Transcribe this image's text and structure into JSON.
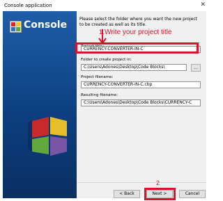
{
  "window": {
    "title": "Console application",
    "close_glyph": "✕"
  },
  "logo": {
    "text": "Console",
    "icon": "console-app-icon"
  },
  "description": "Please select the folder where you want the new project to be created as well as its title.",
  "fields": {
    "project_title": {
      "label": "Project title:",
      "value": "CURRENCY-CONVERTER-IN-C"
    },
    "folder": {
      "label": "Folder to create project in:",
      "value": "C:\\Users\\Adones\\Desktop\\Code Blocks\\",
      "browse_label": "..."
    },
    "project_filename": {
      "label": "Project filename:",
      "value": "CURRENCY-CONVERTER-IN-C.cbp"
    },
    "resulting_filename": {
      "label": "Resulting filename:",
      "value": "C:\\Users\\Adones\\Desktop\\Code Blocks\\CURRENCY-C"
    }
  },
  "annotations": {
    "step1_number": "1.",
    "step1_text": "Write your project title",
    "step2_number": "2",
    "color": "#e0102a"
  },
  "buttons": {
    "back": "< Back",
    "next": "Next >",
    "cancel": "Cancel"
  }
}
